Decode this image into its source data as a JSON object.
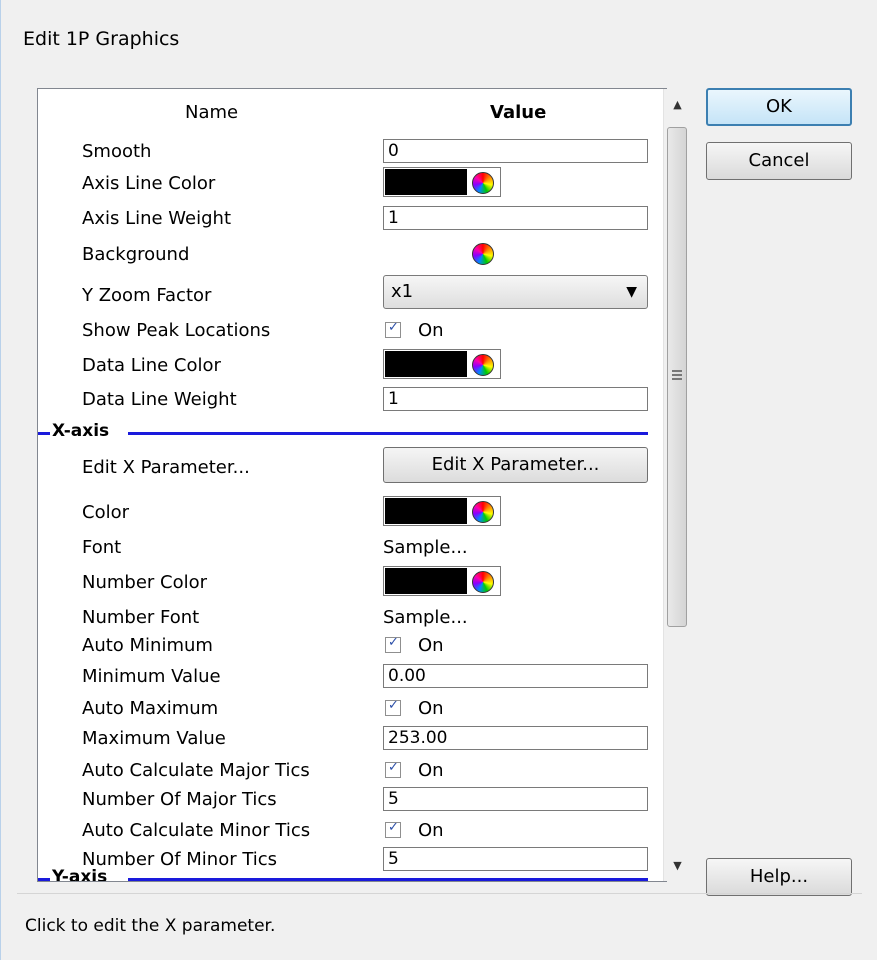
{
  "window": {
    "title": "Edit 1P Graphics"
  },
  "grid": {
    "header": {
      "name": "Name",
      "value": "Value"
    },
    "rows": [
      {
        "label": "Smooth",
        "type": "text",
        "value": "0"
      },
      {
        "label": "Axis Line Color",
        "type": "color",
        "value_color": "#000000"
      },
      {
        "label": "Axis Line Weight",
        "type": "text",
        "value": "1"
      },
      {
        "label": "Background",
        "type": "color",
        "value_color": "#ffffff"
      },
      {
        "label": "Y Zoom Factor",
        "type": "select",
        "value": "x1"
      },
      {
        "label": "Show Peak Locations",
        "type": "checkbox",
        "checked": true,
        "value": "On"
      },
      {
        "label": "Data Line Color",
        "type": "color",
        "value_color": "#000000"
      },
      {
        "label": "Data Line Weight",
        "type": "text",
        "value": "1"
      }
    ],
    "section_x": "X-axis",
    "x_rows": [
      {
        "label": "Edit X Parameter...",
        "type": "button",
        "value": "Edit X Parameter..."
      },
      {
        "label": "Color",
        "type": "color",
        "value_color": "#000000"
      },
      {
        "label": "Font",
        "type": "plain",
        "value": "Sample..."
      },
      {
        "label": "Number Color",
        "type": "color",
        "value_color": "#000000"
      },
      {
        "label": "Number Font",
        "type": "plain",
        "value": "Sample..."
      },
      {
        "label": "Auto Minimum",
        "type": "checkbox",
        "checked": true,
        "value": "On"
      },
      {
        "label": "Minimum Value",
        "type": "text",
        "value": "0.00"
      },
      {
        "label": "Auto Maximum",
        "type": "checkbox",
        "checked": true,
        "value": "On"
      },
      {
        "label": "Maximum Value",
        "type": "text",
        "value": "253.00"
      },
      {
        "label": "Auto Calculate Major Tics",
        "type": "checkbox",
        "checked": true,
        "value": "On"
      },
      {
        "label": "Number Of Major Tics",
        "type": "text",
        "value": "5"
      },
      {
        "label": "Auto Calculate Minor Tics",
        "type": "checkbox",
        "checked": true,
        "value": "On"
      },
      {
        "label": "Number Of Minor Tics",
        "type": "text",
        "value": "5"
      }
    ],
    "section_y": "Y-axis"
  },
  "buttons": {
    "ok": "OK",
    "cancel": "Cancel",
    "help": "Help..."
  },
  "status": "Click to edit the X parameter."
}
